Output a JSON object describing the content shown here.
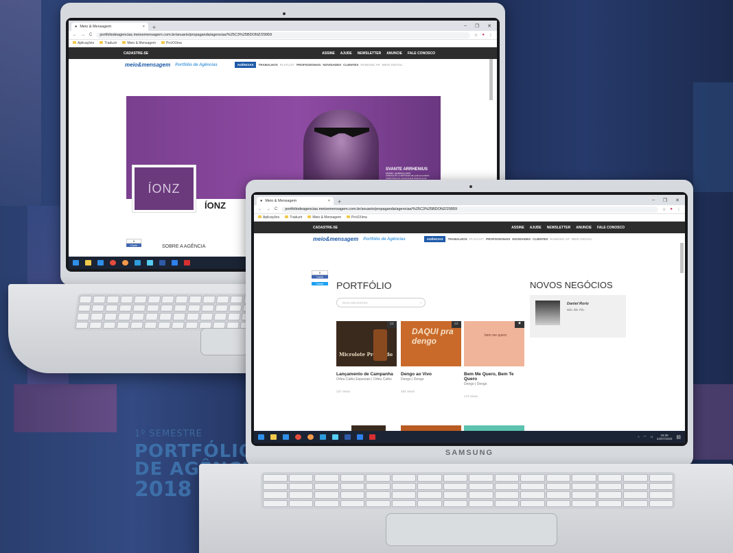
{
  "caption": {
    "semester": "1º SEMESTRE",
    "line1": "PORTFÓLIO",
    "line2": "DE AGÊNCIAS",
    "year": "2018"
  },
  "browser": {
    "tab_title": "Meio & Mensagem",
    "url": "portfoliodeagencias.meioemensagem.com.br/anuario/propaganda/agencias/%25C3%25BDONZ/29959",
    "bookmarks": [
      "Aplicações",
      "Traduzir",
      "Meio & Mensagem",
      "ProXXIma"
    ]
  },
  "site": {
    "cadastre": "CADASTRE-SE",
    "top_links": [
      "ASSINE",
      "AJUDE",
      "NEWSLETTER",
      "ANUNCIE",
      "FALE CONOSCO"
    ],
    "logo": "meio&mensagem",
    "logo_sub": "Portfólio de Agências",
    "nav": [
      "AGÊNCIAS",
      "TRABALHOS",
      "PLAYLIST",
      "PROFISSIONAIS",
      "NOVIDADES",
      "CLIENTES",
      "RANKING AP",
      "MEIO DIGITAL"
    ],
    "like_label": "Curtir",
    "tweet_label": "Tweet",
    "like_count": "0"
  },
  "back_laptop": {
    "agency_name": "ÍONZ",
    "agency_logo_text": "ÍONZ",
    "about": "SOBRE A AGÊNCIA",
    "banner_name": "SVANTE ARRHENIUS",
    "banner_sub": "NOBEL QUÍMICA 1903",
    "banner_text": "FORMULOU A HIPÓTESE DE QUE ALGUMAS SUBSTÂNCIAS CONTINHAM PARTÍCULAS CARREGADAS, OS ÍONS"
  },
  "front_laptop": {
    "portfolio_title": "PORTFÓLIO",
    "select_placeholder": "MAIS RECENTES",
    "news_title": "NOVOS NEGÓCIOS",
    "news_person": "Daniel Roriz",
    "news_role": "Sóc. Dir. Fin.",
    "cards": [
      {
        "title": "Lançamento de Campanha",
        "sub": "Orfeu Cafés Especiais | Orfeu Cafés",
        "views": "237 views",
        "art": "Microlote Premiado",
        "color": "#3a2a1e"
      },
      {
        "title": "Dengo ao Vivo",
        "sub": "Dengo | Dengo",
        "views": "184 views",
        "art": "DAQUI pra dengo",
        "color": "#c96a2a"
      },
      {
        "title": "Bem Me Quero, Bem Te Quero",
        "sub": "Dengo | Dengo",
        "views": "173 views",
        "art": "bem me quero",
        "color": "#f0b49a"
      }
    ],
    "clock_time": "18:36",
    "clock_date": "24/07/2020",
    "brand": "SAMSUNG"
  }
}
